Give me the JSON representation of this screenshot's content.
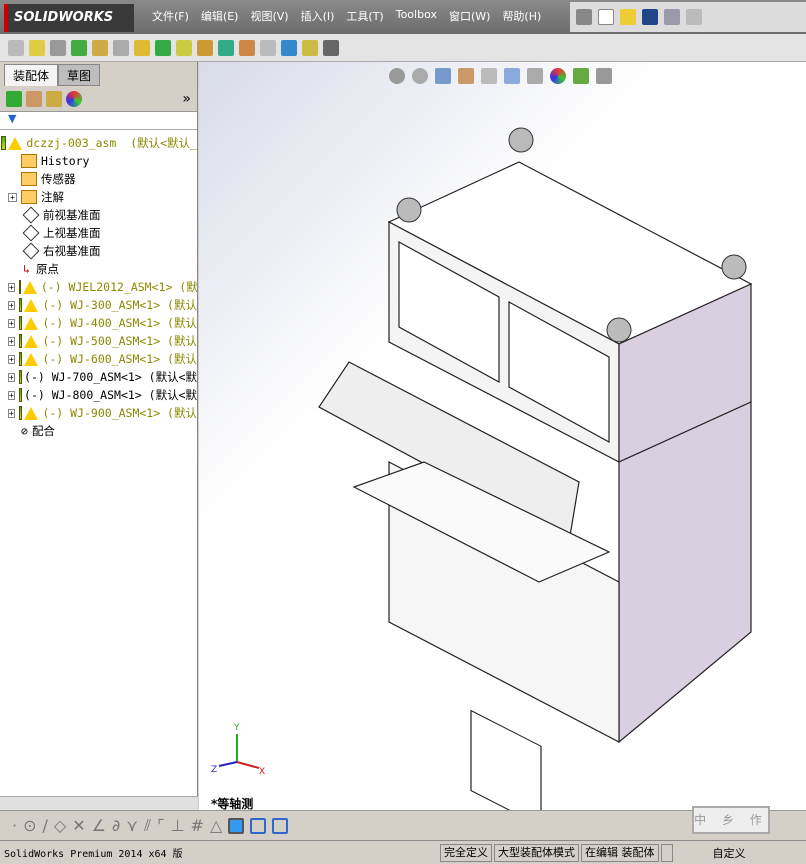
{
  "app": {
    "logo": "SOLIDWORKS"
  },
  "menu": [
    "文件(F)",
    "编辑(E)",
    "视图(V)",
    "插入(I)",
    "工具(T)",
    "Toolbox",
    "窗口(W)",
    "帮助(H)"
  ],
  "panel": {
    "tabs": [
      "装配体",
      "草图"
    ],
    "expand": "»"
  },
  "tree": {
    "root": {
      "name": "dczzj-003_asm",
      "config": "(默认<默认_"
    },
    "items": [
      {
        "label": "History"
      },
      {
        "label": "传感器"
      },
      {
        "label": "注解"
      },
      {
        "label": "前视基准面"
      },
      {
        "label": "上视基准面"
      },
      {
        "label": "右视基准面"
      },
      {
        "label": "原点"
      }
    ],
    "components": [
      {
        "label": "(-) WJEL2012_ASM<1> (默",
        "warn": true
      },
      {
        "label": "(-) WJ-300_ASM<1> (默认",
        "warn": true
      },
      {
        "label": "(-) WJ-400_ASM<1> (默认",
        "warn": true
      },
      {
        "label": "(-) WJ-500_ASM<1> (默认",
        "warn": true
      },
      {
        "label": "(-) WJ-600_ASM<1> (默认",
        "warn": true
      },
      {
        "label": "(-) WJ-700_ASM<1> (默认<默",
        "warn": false
      },
      {
        "label": "(-) WJ-800_ASM<1> (默认<默",
        "warn": false
      },
      {
        "label": "(-) WJ-900_ASM<1> (默认",
        "warn": true
      }
    ],
    "mates": "配合"
  },
  "viewport": {
    "view_name": "*等轴测",
    "triad": {
      "x": "X",
      "y": "Y",
      "z": "Z"
    }
  },
  "stamp": "中 乡 作",
  "status": {
    "product": "SolidWorks Premium 2014 x64 版",
    "cells": [
      "完全定义",
      "大型装配体模式",
      "在编辑 装配体"
    ],
    "custom": "自定义"
  }
}
